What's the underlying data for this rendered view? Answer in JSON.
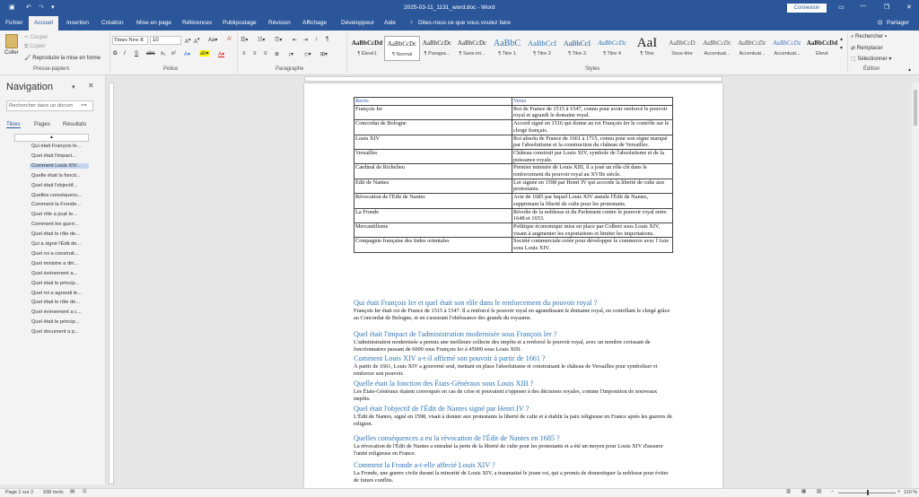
{
  "titlebar": {
    "title": "2025-03-11_1131_word.doc - Word",
    "signin": "Connexion",
    "minimize": "—",
    "restore": "❐",
    "close": "✕",
    "ribbon_options": "▭"
  },
  "menu": {
    "items": [
      "Fichier",
      "Accueil",
      "Insertion",
      "Création",
      "Mise en page",
      "Références",
      "Publipostage",
      "Révision",
      "Affichage",
      "Développeur",
      "Aide"
    ],
    "search": "Dites-nous ce que vous voulez faire",
    "share": "Partager",
    "active": "Accueil"
  },
  "ribbon": {
    "clipboard": {
      "paste": "Coller",
      "cut": "Couper",
      "copy": "Copier",
      "format_painter": "Reproduire la mise en forme",
      "label": "Presse-papiers"
    },
    "font": {
      "name": "Times New R",
      "size": "10",
      "label": "Police",
      "bold": "G",
      "italic": "I",
      "underline": "S",
      "strike": "abc",
      "sub": "x₂",
      "sup": "x²"
    },
    "paragraph": {
      "label": "Paragraphe"
    },
    "styles": {
      "label": "Styles",
      "items": [
        {
          "preview": "AaBbCcDd",
          "name": "¶ Élevé1"
        },
        {
          "preview": "AaBbCcDc",
          "name": "¶ Normal"
        },
        {
          "preview": "AaBbCcDc",
          "name": "¶ Paragra..."
        },
        {
          "preview": "AaBbCcDc",
          "name": "¶ Sans int..."
        },
        {
          "preview": "AaBbC",
          "name": "¶ Titre 1"
        },
        {
          "preview": "AaBbCcI",
          "name": "¶ Titre 2"
        },
        {
          "preview": "AaBbCcI",
          "name": "¶ Titre 3"
        },
        {
          "preview": "AaBbCcDc",
          "name": "¶ Titre 4"
        },
        {
          "preview": "AaI",
          "name": "¶ Titre"
        },
        {
          "preview": "AaBbCcD",
          "name": "Sous-titre"
        },
        {
          "preview": "AaBbCcDc",
          "name": "Accentuat..."
        },
        {
          "preview": "AaBbCcDc",
          "name": "Accentuat..."
        },
        {
          "preview": "AaBbCcDc",
          "name": "Accentuat..."
        },
        {
          "preview": "AaBbCcDd",
          "name": "Élevé"
        }
      ]
    },
    "editing": {
      "find": "Rechercher",
      "replace": "Remplacer",
      "select": "Sélectionner",
      "label": "Édition"
    }
  },
  "navigation": {
    "title": "Navigation",
    "search_placeholder": "Rechercher dans un docum",
    "tabs": [
      "Titres",
      "Pages",
      "Résultats"
    ],
    "items": [
      "Qui était François le...",
      "Quel était l'impact...",
      "Comment Louis XIV...",
      "Quelle était la foncti...",
      "Quel était l'objectif...",
      "Quelles conséquenc...",
      "Comment la Fronde...",
      "Quel rôle a joué le...",
      "Comment les guerr...",
      "Quel était le rôle de...",
      "Qui a signé l'Édit de...",
      "Quel roi a construit...",
      "Quel ministre a diri...",
      "Quel évènement a...",
      "Quel était le princip...",
      "Quel roi a agrandi le...",
      "Quel était le rôle de...",
      "Quel évènement a c...",
      "Quel était le princip...",
      "Quel document a p..."
    ],
    "selected_index": 2
  },
  "document": {
    "table_header": [
      "Recto",
      "Verso"
    ],
    "table_rows": [
      [
        "François Ier",
        "Roi de France de 1515 à 1547, connu pour avoir renforcé le pouvoir royal et agrandi le domaine royal."
      ],
      [
        "Concordat de Bologne",
        "Accord signé en 1516 qui donne au roi François Ier le contrôle sur le clergé français."
      ],
      [
        "Louis XIV",
        "Roi absolu de France de 1661 à 1715, connu pour son règne marqué par l'absolutisme et la construction du château de Versailles."
      ],
      [
        "Versailles",
        "Château construit par Louis XIV, symbole de l'absolutisme et de la puissance royale."
      ],
      [
        "Cardinal de Richelieu",
        "Premier ministre de Louis XIII, il a joué un rôle clé dans le renforcement du pouvoir royal au XVIIe siècle."
      ],
      [
        "Édit de Nantes",
        "Loi signée en 1598 par Henri IV qui accorde la liberté de culte aux protestants."
      ],
      [
        "Révocation de l'Édit de Nantes",
        "Acte de 1685 par lequel Louis XIV annule l'Édit de Nantes, supprimant la liberté de culte pour les protestants."
      ],
      [
        "La Fronde",
        "Révolte de la noblesse et du Parlement contre le pouvoir royal entre 1648 et 1653."
      ],
      [
        "Mercantilisme",
        "Politique économique mise en place par Colbert sous Louis XIV, visant à augmenter les exportations et limiter les importations."
      ],
      [
        "Compagnie française des Indes orientales",
        "Société commerciale créée pour développer le commerce avec l'Asie sous Louis XIV."
      ]
    ],
    "sections": [
      {
        "heading": "Qui était François Ier et quel était son rôle dans le renforcement du pouvoir royal ?",
        "text": "François Ier était roi de France de 1515 à 1547. Il a renforcé le pouvoir royal en agrandissant le domaine royal, en contrôlant le clergé grâce au Concordat de Bologne, et en s'assurant l'obéissance des grands du royaume."
      },
      {
        "heading": "Quel était l'impact de l'administration modernisée sous François Ier ?",
        "text": "L'administration modernisée a permis une meilleure collecte des impôts et a renforcé le pouvoir royal, avec un nombre croissant de fonctionnaires passant de 6000 sous François Ier à 45000 sous Louis XIII."
      },
      {
        "heading": "Comment Louis XIV a-t-il affirmé son pouvoir à partir de 1661 ?",
        "text": "À partir de 1661, Louis XIV a gouverné seul, mettant en place l'absolutisme et construisant le château de Versailles pour symboliser et renforcer son pouvoir."
      },
      {
        "heading": "Quelle était la fonction des États-Généraux sous Louis XIII ?",
        "text": "Les États-Généraux étaient convoqués en cas de crise et pouvaient s'opposer à des décisions royales, comme l'imposition de nouveaux impôts."
      },
      {
        "heading": "Quel était l'objectif de l'Édit de Nantes signé par Henri IV ?",
        "text": "L'Édit de Nantes, signé en 1598, visait à donner aux protestants la liberté de culte et à établir la paix religieuse en France après les guerres de religion."
      },
      {
        "heading": "Quelles conséquences a eu la révocation de l'Édit de Nantes en 1685 ?",
        "text": "La révocation de l'Édit de Nantes a entraîné la perte de la liberté de culte pour les protestants et a été un moyen pour Louis XIV d'assurer l'unité religieuse en France."
      },
      {
        "heading": "Comment la Fronde a-t-elle affecté Louis XIV ?",
        "text": "La Fronde, une guerre civile durant la minorité de Louis XIV, a traumatisé le jeune roi, qui a promis de domestiquer la noblesse pour éviter de futurs conflits."
      }
    ]
  },
  "status": {
    "page": "Page 1 sur 2",
    "words": "938 mots",
    "zoom": "110 %"
  },
  "colors": {
    "brand": "#2b579a",
    "heading": "#2e74b5"
  }
}
